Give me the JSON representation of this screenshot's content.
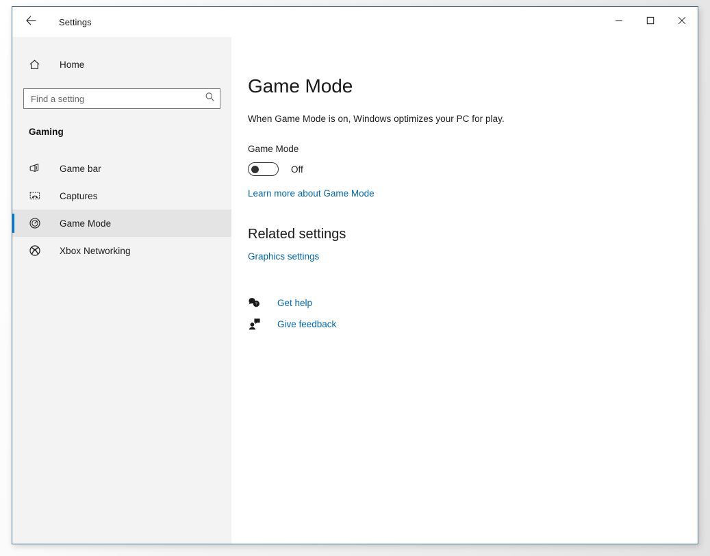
{
  "window": {
    "title": "Settings",
    "back_icon": "back-arrow-icon",
    "controls": {
      "minimize": "minimize-icon",
      "maximize": "maximize-icon",
      "close": "close-icon"
    }
  },
  "sidebar": {
    "home": {
      "label": "Home",
      "icon": "home-icon"
    },
    "search": {
      "placeholder": "Find a setting",
      "value": "",
      "icon": "search-icon"
    },
    "category": "Gaming",
    "items": [
      {
        "label": "Game bar",
        "icon": "game-bar-icon",
        "selected": false
      },
      {
        "label": "Captures",
        "icon": "captures-icon",
        "selected": false
      },
      {
        "label": "Game Mode",
        "icon": "game-mode-icon",
        "selected": true
      },
      {
        "label": "Xbox Networking",
        "icon": "xbox-icon",
        "selected": false
      }
    ]
  },
  "main": {
    "title": "Game Mode",
    "description": "When Game Mode is on, Windows optimizes your PC for play.",
    "toggle": {
      "label": "Game Mode",
      "state": "Off",
      "checked": false
    },
    "learn_more": "Learn more about Game Mode",
    "related": {
      "title": "Related settings",
      "links": [
        {
          "label": "Graphics settings"
        }
      ]
    },
    "support": [
      {
        "label": "Get help",
        "icon": "get-help-icon"
      },
      {
        "label": "Give feedback",
        "icon": "give-feedback-icon"
      }
    ]
  },
  "colors": {
    "accent": "#0078d4",
    "link": "#0067b8",
    "sidebar_bg": "#f3f3f3",
    "content_bg": "#ffffff",
    "window_border": "#4a6f8a"
  }
}
